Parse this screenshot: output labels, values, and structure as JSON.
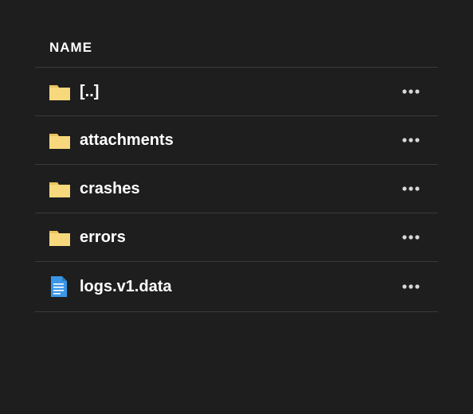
{
  "header": {
    "name": "NAME"
  },
  "colors": {
    "folder_fill": "#f7d87c",
    "folder_tab": "#e8c35f",
    "file_fill": "#3a97e8",
    "file_line": "#ffffff",
    "more": "#d7d7d7",
    "text": "#ffffff"
  },
  "rows": [
    {
      "type": "folder",
      "label": "[..]"
    },
    {
      "type": "folder",
      "label": "attachments"
    },
    {
      "type": "folder",
      "label": "crashes"
    },
    {
      "type": "folder",
      "label": "errors"
    },
    {
      "type": "file",
      "label": "logs.v1.data"
    }
  ]
}
